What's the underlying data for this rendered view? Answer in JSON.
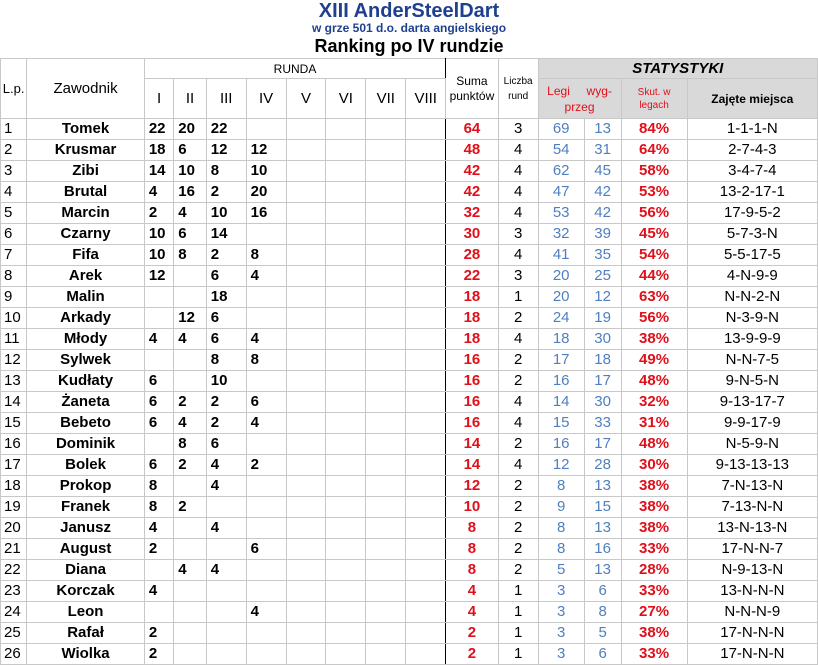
{
  "header": {
    "title": "XIII AnderSteelDart",
    "subtitle": "w grze 501 d.o. darta angielskiego",
    "ranking": "Ranking po IV rundzie"
  },
  "columns": {
    "lp": "L.p.",
    "player": "Zawodnik",
    "runda": "RUNDA",
    "rounds": [
      "I",
      "II",
      "III",
      "IV",
      "V",
      "VI",
      "VII",
      "VIII"
    ],
    "sum_line1": "Suma",
    "sum_line2": "punktów",
    "rounds_count_line1": "Liczba",
    "rounds_count_line2": "rund",
    "stats": "STATYSTYKI",
    "legs_line1_a": "Legi",
    "legs_line1_b": "wyg-",
    "legs_line2": "przeg",
    "eff_line1": "Skut. w",
    "eff_line2": "legach",
    "places": "Zajęte miejsca"
  },
  "rows": [
    {
      "lp": "1",
      "name": "Tomek",
      "r": [
        "22",
        "20",
        "22",
        "",
        "",
        "",
        "",
        ""
      ],
      "sum": "64",
      "n": "3",
      "won": "69",
      "lost": "13",
      "eff": "84%",
      "places": "1-1-1-N"
    },
    {
      "lp": "2",
      "name": "Krusmar",
      "r": [
        "18",
        "6",
        "12",
        "12",
        "",
        "",
        "",
        ""
      ],
      "sum": "48",
      "n": "4",
      "won": "54",
      "lost": "31",
      "eff": "64%",
      "places": "2-7-4-3"
    },
    {
      "lp": "3",
      "name": "Zibi",
      "r": [
        "14",
        "10",
        "8",
        "10",
        "",
        "",
        "",
        ""
      ],
      "sum": "42",
      "n": "4",
      "won": "62",
      "lost": "45",
      "eff": "58%",
      "places": "3-4-7-4"
    },
    {
      "lp": "4",
      "name": "Brutal",
      "r": [
        "4",
        "16",
        "2",
        "20",
        "",
        "",
        "",
        ""
      ],
      "sum": "42",
      "n": "4",
      "won": "47",
      "lost": "42",
      "eff": "53%",
      "places": "13-2-17-1"
    },
    {
      "lp": "5",
      "name": "Marcin",
      "r": [
        "2",
        "4",
        "10",
        "16",
        "",
        "",
        "",
        ""
      ],
      "sum": "32",
      "n": "4",
      "won": "53",
      "lost": "42",
      "eff": "56%",
      "places": "17-9-5-2"
    },
    {
      "lp": "6",
      "name": "Czarny",
      "r": [
        "10",
        "6",
        "14",
        "",
        "",
        "",
        "",
        ""
      ],
      "sum": "30",
      "n": "3",
      "won": "32",
      "lost": "39",
      "eff": "45%",
      "places": "5-7-3-N"
    },
    {
      "lp": "7",
      "name": "Fifa",
      "r": [
        "10",
        "8",
        "2",
        "8",
        "",
        "",
        "",
        ""
      ],
      "sum": "28",
      "n": "4",
      "won": "41",
      "lost": "35",
      "eff": "54%",
      "places": "5-5-17-5"
    },
    {
      "lp": "8",
      "name": "Arek",
      "r": [
        "12",
        "",
        "6",
        "4",
        "",
        "",
        "",
        ""
      ],
      "sum": "22",
      "n": "3",
      "won": "20",
      "lost": "25",
      "eff": "44%",
      "places": "4-N-9-9"
    },
    {
      "lp": "9",
      "name": "Malin",
      "r": [
        "",
        "",
        "18",
        "",
        "",
        "",
        "",
        ""
      ],
      "sum": "18",
      "n": "1",
      "won": "20",
      "lost": "12",
      "eff": "63%",
      "places": "N-N-2-N"
    },
    {
      "lp": "10",
      "name": "Arkady",
      "r": [
        "",
        "12",
        "6",
        "",
        "",
        "",
        "",
        ""
      ],
      "sum": "18",
      "n": "2",
      "won": "24",
      "lost": "19",
      "eff": "56%",
      "places": "N-3-9-N"
    },
    {
      "lp": "11",
      "name": "Młody",
      "r": [
        "4",
        "4",
        "6",
        "4",
        "",
        "",
        "",
        ""
      ],
      "sum": "18",
      "n": "4",
      "won": "18",
      "lost": "30",
      "eff": "38%",
      "places": "13-9-9-9"
    },
    {
      "lp": "12",
      "name": "Sylwek",
      "r": [
        "",
        "",
        "8",
        "8",
        "",
        "",
        "",
        ""
      ],
      "sum": "16",
      "n": "2",
      "won": "17",
      "lost": "18",
      "eff": "49%",
      "places": "N-N-7-5"
    },
    {
      "lp": "13",
      "name": "Kudłaty",
      "r": [
        "6",
        "",
        "10",
        "",
        "",
        "",
        "",
        ""
      ],
      "sum": "16",
      "n": "2",
      "won": "16",
      "lost": "17",
      "eff": "48%",
      "places": "9-N-5-N"
    },
    {
      "lp": "14",
      "name": "Żaneta",
      "r": [
        "6",
        "2",
        "2",
        "6",
        "",
        "",
        "",
        ""
      ],
      "sum": "16",
      "n": "4",
      "won": "14",
      "lost": "30",
      "eff": "32%",
      "places": "9-13-17-7"
    },
    {
      "lp": "15",
      "name": "Bebeto",
      "r": [
        "6",
        "4",
        "2",
        "4",
        "",
        "",
        "",
        ""
      ],
      "sum": "16",
      "n": "4",
      "won": "15",
      "lost": "33",
      "eff": "31%",
      "places": "9-9-17-9"
    },
    {
      "lp": "16",
      "name": "Dominik",
      "r": [
        "",
        "8",
        "6",
        "",
        "",
        "",
        "",
        ""
      ],
      "sum": "14",
      "n": "2",
      "won": "16",
      "lost": "17",
      "eff": "48%",
      "places": "N-5-9-N"
    },
    {
      "lp": "17",
      "name": "Bolek",
      "r": [
        "6",
        "2",
        "4",
        "2",
        "",
        "",
        "",
        ""
      ],
      "sum": "14",
      "n": "4",
      "won": "12",
      "lost": "28",
      "eff": "30%",
      "places": "9-13-13-13"
    },
    {
      "lp": "18",
      "name": "Prokop",
      "r": [
        "8",
        "",
        "4",
        "",
        "",
        "",
        "",
        ""
      ],
      "sum": "12",
      "n": "2",
      "won": "8",
      "lost": "13",
      "eff": "38%",
      "places": "7-N-13-N"
    },
    {
      "lp": "19",
      "name": "Franek",
      "r": [
        "8",
        "2",
        "",
        "",
        "",
        "",
        "",
        ""
      ],
      "sum": "10",
      "n": "2",
      "won": "9",
      "lost": "15",
      "eff": "38%",
      "places": "7-13-N-N"
    },
    {
      "lp": "20",
      "name": "Janusz",
      "r": [
        "4",
        "",
        "4",
        "",
        "",
        "",
        "",
        ""
      ],
      "sum": "8",
      "n": "2",
      "won": "8",
      "lost": "13",
      "eff": "38%",
      "places": "13-N-13-N"
    },
    {
      "lp": "21",
      "name": "August",
      "r": [
        "2",
        "",
        "",
        "6",
        "",
        "",
        "",
        ""
      ],
      "sum": "8",
      "n": "2",
      "won": "8",
      "lost": "16",
      "eff": "33%",
      "places": "17-N-N-7"
    },
    {
      "lp": "22",
      "name": "Diana",
      "r": [
        "",
        "4",
        "4",
        "",
        "",
        "",
        "",
        ""
      ],
      "sum": "8",
      "n": "2",
      "won": "5",
      "lost": "13",
      "eff": "28%",
      "places": "N-9-13-N"
    },
    {
      "lp": "23",
      "name": "Korczak",
      "r": [
        "4",
        "",
        "",
        "",
        "",
        "",
        "",
        ""
      ],
      "sum": "4",
      "n": "1",
      "won": "3",
      "lost": "6",
      "eff": "33%",
      "places": "13-N-N-N"
    },
    {
      "lp": "24",
      "name": "Leon",
      "r": [
        "",
        "",
        "",
        "4",
        "",
        "",
        "",
        ""
      ],
      "sum": "4",
      "n": "1",
      "won": "3",
      "lost": "8",
      "eff": "27%",
      "places": "N-N-N-9"
    },
    {
      "lp": "25",
      "name": "Rafał",
      "r": [
        "2",
        "",
        "",
        "",
        "",
        "",
        "",
        ""
      ],
      "sum": "2",
      "n": "1",
      "won": "3",
      "lost": "5",
      "eff": "38%",
      "places": "17-N-N-N"
    },
    {
      "lp": "26",
      "name": "Wiolka",
      "r": [
        "2",
        "",
        "",
        "",
        "",
        "",
        "",
        ""
      ],
      "sum": "2",
      "n": "1",
      "won": "3",
      "lost": "6",
      "eff": "33%",
      "places": "17-N-N-N"
    }
  ],
  "colors": {
    "title": "#1f3f8f",
    "sum": "#e0101a",
    "legs": "#4f7fbf",
    "eff": "#e0101a",
    "stats_bg": "#d9d9d9"
  }
}
